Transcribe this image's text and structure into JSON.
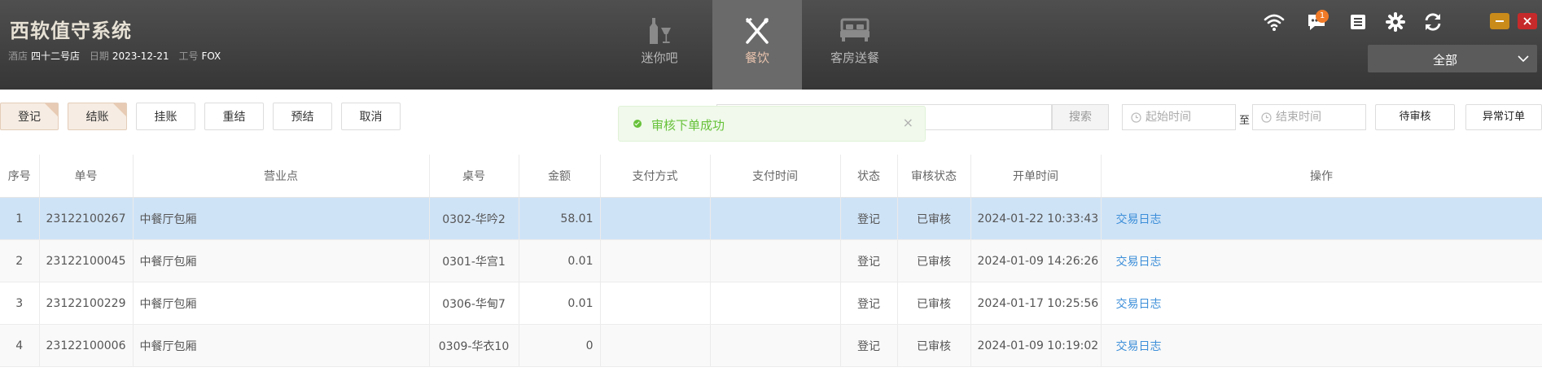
{
  "header": {
    "brand": "西软值守系统",
    "hotel_label": "酒店",
    "hotel_value": "四十二号店",
    "date_label": "日期",
    "date_value": "2023-12-21",
    "staff_label": "工号",
    "staff_value": "FOX",
    "nav": [
      {
        "label": "迷你吧",
        "icon": "minibar-bottle-icon",
        "active": false
      },
      {
        "label": "餐饮",
        "icon": "fork-knife-icon",
        "active": true
      },
      {
        "label": "客房送餐",
        "icon": "bed-icon",
        "active": false
      }
    ],
    "notification_count": "1",
    "scope_select": "全部",
    "colors": {
      "active_tab": "#6a6a6a",
      "minimize": "#c98b1a",
      "close": "#c62a2a",
      "badge": "#f07a27"
    }
  },
  "toolbar": {
    "buttons": [
      {
        "label": "登记",
        "active": true
      },
      {
        "label": "结账",
        "active": true
      },
      {
        "label": "挂账",
        "active": false
      },
      {
        "label": "重结",
        "active": false
      },
      {
        "label": "预结",
        "active": false
      },
      {
        "label": "取消",
        "active": false
      }
    ],
    "search_button": "搜索",
    "start_placeholder": "起始时间",
    "to_label": "至",
    "end_placeholder": "结束时间",
    "pending_button": "待审核",
    "abnormal_button": "异常订单"
  },
  "toast": {
    "message": "审核下单成功",
    "close_glyph": "×"
  },
  "table": {
    "columns": [
      "序号",
      "单号",
      "营业点",
      "桌号",
      "金额",
      "支付方式",
      "支付时间",
      "状态",
      "审核状态",
      "开单时间",
      "操作"
    ],
    "rows": [
      {
        "no": "1",
        "order": "23122100267",
        "outlet": "中餐厅包厢",
        "table": "0302-华吟2",
        "amount": "58.01",
        "pay_method": "",
        "pay_time": "",
        "status": "登记",
        "audit": "已审核",
        "open_time": "2024-01-22 10:33:43",
        "action": "交易日志"
      },
      {
        "no": "2",
        "order": "23122100045",
        "outlet": "中餐厅包厢",
        "table": "0301-华宫1",
        "amount": "0.01",
        "pay_method": "",
        "pay_time": "",
        "status": "登记",
        "audit": "已审核",
        "open_time": "2024-01-09 14:26:26",
        "action": "交易日志"
      },
      {
        "no": "3",
        "order": "23122100229",
        "outlet": "中餐厅包厢",
        "table": "0306-华甸7",
        "amount": "0.01",
        "pay_method": "",
        "pay_time": "",
        "status": "登记",
        "audit": "已审核",
        "open_time": "2024-01-17 10:25:56",
        "action": "交易日志"
      },
      {
        "no": "4",
        "order": "23122100006",
        "outlet": "中餐厅包厢",
        "table": "0309-华衣10",
        "amount": "0",
        "pay_method": "",
        "pay_time": "",
        "status": "登记",
        "audit": "已审核",
        "open_time": "2024-01-09 10:19:02",
        "action": "交易日志"
      }
    ]
  }
}
